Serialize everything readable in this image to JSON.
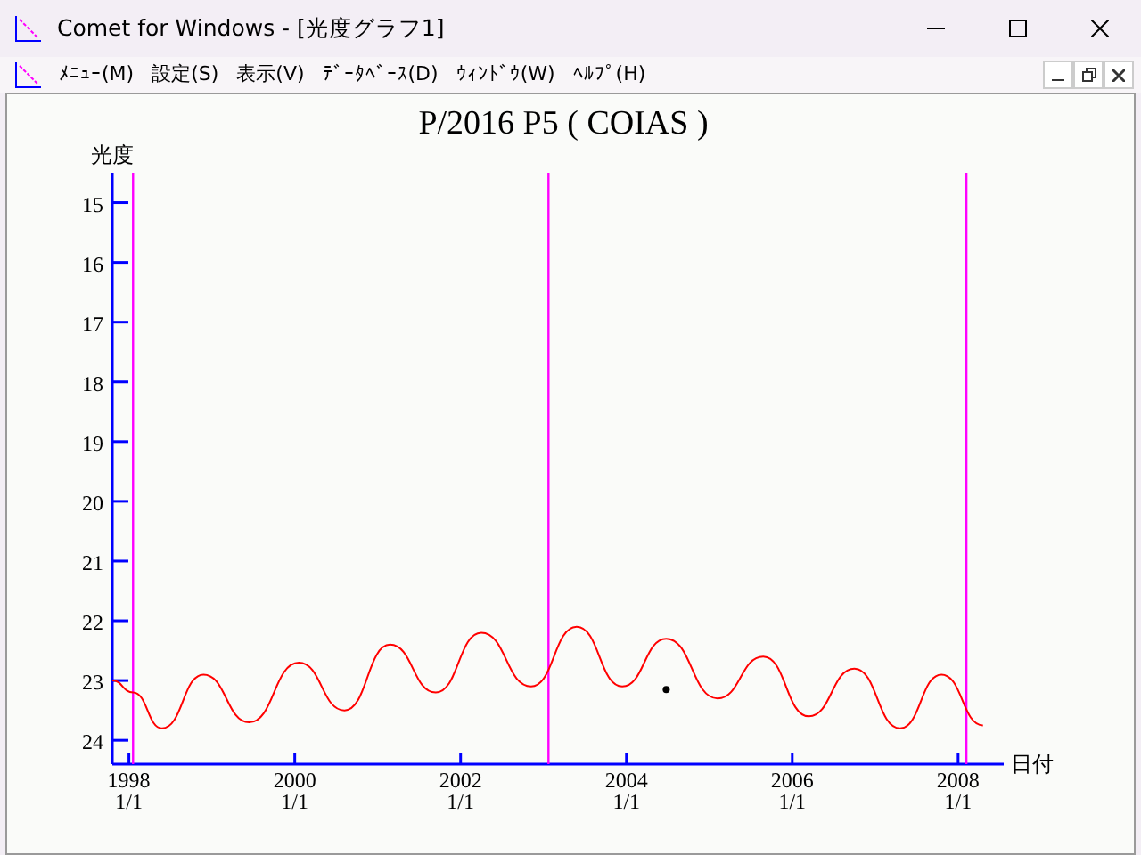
{
  "window": {
    "title": "Comet for Windows - [光度グラフ1]"
  },
  "menu": [
    "ﾒﾆｭｰ(M)",
    "設定(S)",
    "表示(V)",
    "ﾃﾞｰﾀﾍﾞｰｽ(D)",
    "ｳｨﾝﾄﾞｳ(W)",
    "ﾍﾙﾌﾟ(H)"
  ],
  "graph": {
    "chart_data": {
      "type": "line",
      "title": "P/2016 P5 ( COIAS )",
      "xlabel": "日付",
      "ylabel": "光度",
      "xlim": [
        1997.8,
        2008.55
      ],
      "ylim": [
        24.4,
        14.5
      ],
      "xticks": [
        1998,
        2000,
        2002,
        2004,
        2006,
        2008
      ],
      "yticks": [
        15,
        16,
        17,
        18,
        19,
        20,
        21,
        22,
        23,
        24
      ],
      "x": [
        1997.8,
        1998.05,
        1998.4,
        1998.9,
        1999.45,
        2000.05,
        2000.6,
        2001.15,
        2001.7,
        2002.25,
        2002.85,
        2003.4,
        2003.95,
        2004.48,
        2005.1,
        2005.65,
        2006.2,
        2006.75,
        2007.3,
        2007.8,
        2008.3
      ],
      "series": [
        {
          "color": "#ff0000",
          "values": [
            23.0,
            23.2,
            23.8,
            22.9,
            23.7,
            22.7,
            23.5,
            22.4,
            23.2,
            22.2,
            23.1,
            22.1,
            23.1,
            22.3,
            23.3,
            22.6,
            23.6,
            22.8,
            23.8,
            22.9,
            23.75
          ]
        },
        {
          "color": "#000000",
          "marker": "o",
          "values": [
            null,
            null,
            null,
            null,
            null,
            null,
            null,
            null,
            null,
            null,
            null,
            null,
            null,
            23.15,
            null,
            null,
            null,
            null,
            null,
            null,
            null
          ]
        }
      ],
      "ref_lines": [
        {
          "axis": "x",
          "value": 1998.05
        },
        {
          "axis": "x",
          "value": 2003.06
        },
        {
          "axis": "x",
          "value": 2008.1
        }
      ]
    },
    "date_labels": [
      "1/1",
      "1/1",
      "1/1",
      "1/1",
      "1/1",
      "1/1"
    ]
  }
}
